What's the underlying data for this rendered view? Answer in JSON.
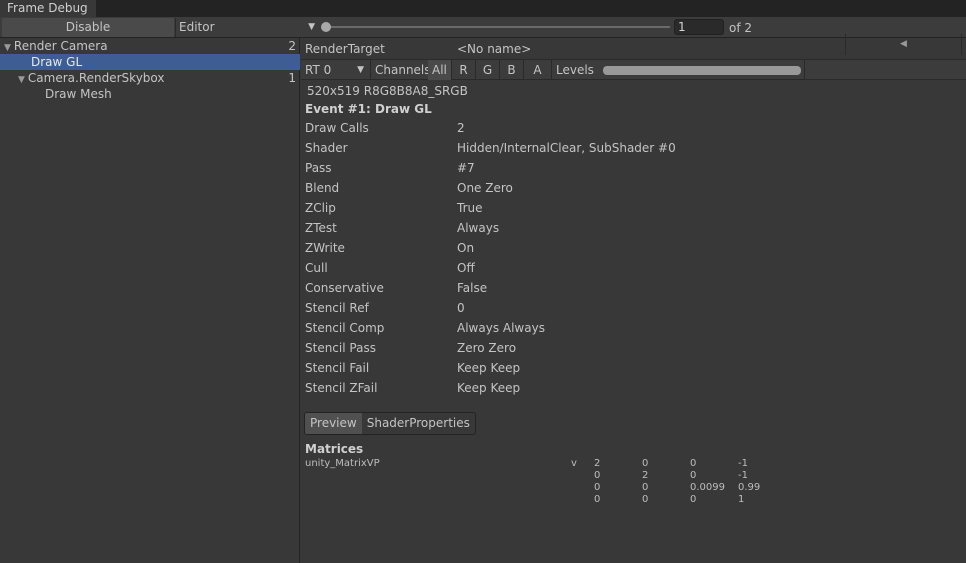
{
  "window": {
    "tab_title": "Frame Debug"
  },
  "toolbar": {
    "disable_label": "Disable",
    "target": "Editor",
    "event_index": "1",
    "event_total": "of 2",
    "slider_fraction": 0.0
  },
  "tree": [
    {
      "label": "Render Camera",
      "count": "2",
      "expanded": true,
      "depth": 0
    },
    {
      "label": "Draw GL",
      "count": "",
      "depth": 1,
      "selected": true
    },
    {
      "label": "Camera.RenderSkybox",
      "count": "1",
      "expanded": true,
      "depth": 1
    },
    {
      "label": "Draw Mesh",
      "count": "",
      "depth": 2
    }
  ],
  "render_target": {
    "label": "RenderTarget",
    "value": "<No name>",
    "rt": "RT 0",
    "channels_label": "Channels",
    "channels": [
      "All",
      "R",
      "G",
      "B",
      "A"
    ],
    "selected_channel": "All",
    "levels_label": "Levels",
    "format": "520x519 R8G8B8A8_SRGB"
  },
  "event": {
    "title": "Event #1: Draw GL",
    "properties": [
      {
        "k": "Draw Calls",
        "v": "2"
      },
      {
        "k": "Shader",
        "v": "Hidden/InternalClear, SubShader #0"
      },
      {
        "k": "Pass",
        "v": "#7"
      },
      {
        "k": "Blend",
        "v": "One Zero"
      },
      {
        "k": "ZClip",
        "v": "True"
      },
      {
        "k": "ZTest",
        "v": "Always"
      },
      {
        "k": "ZWrite",
        "v": "On"
      },
      {
        "k": "Cull",
        "v": "Off"
      },
      {
        "k": "Conservative",
        "v": "False"
      },
      {
        "k": "Stencil Ref",
        "v": "0"
      },
      {
        "k": "Stencil Comp",
        "v": "Always Always"
      },
      {
        "k": "Stencil Pass",
        "v": "Zero Zero"
      },
      {
        "k": "Stencil Fail",
        "v": "Keep Keep"
      },
      {
        "k": "Stencil ZFail",
        "v": "Keep Keep"
      }
    ]
  },
  "bottom_tabs": {
    "preview": "Preview",
    "shader_properties": "ShaderProperties"
  },
  "matrices": {
    "title": "Matrices",
    "items": [
      {
        "name": "unity_MatrixVP",
        "stage": "v",
        "rows": [
          [
            "2",
            "0",
            "0",
            "-1"
          ],
          [
            "0",
            "2",
            "0",
            "-1"
          ],
          [
            "0",
            "0",
            "0.0099",
            "0.99"
          ],
          [
            "0",
            "0",
            "0",
            "1"
          ]
        ]
      }
    ]
  }
}
